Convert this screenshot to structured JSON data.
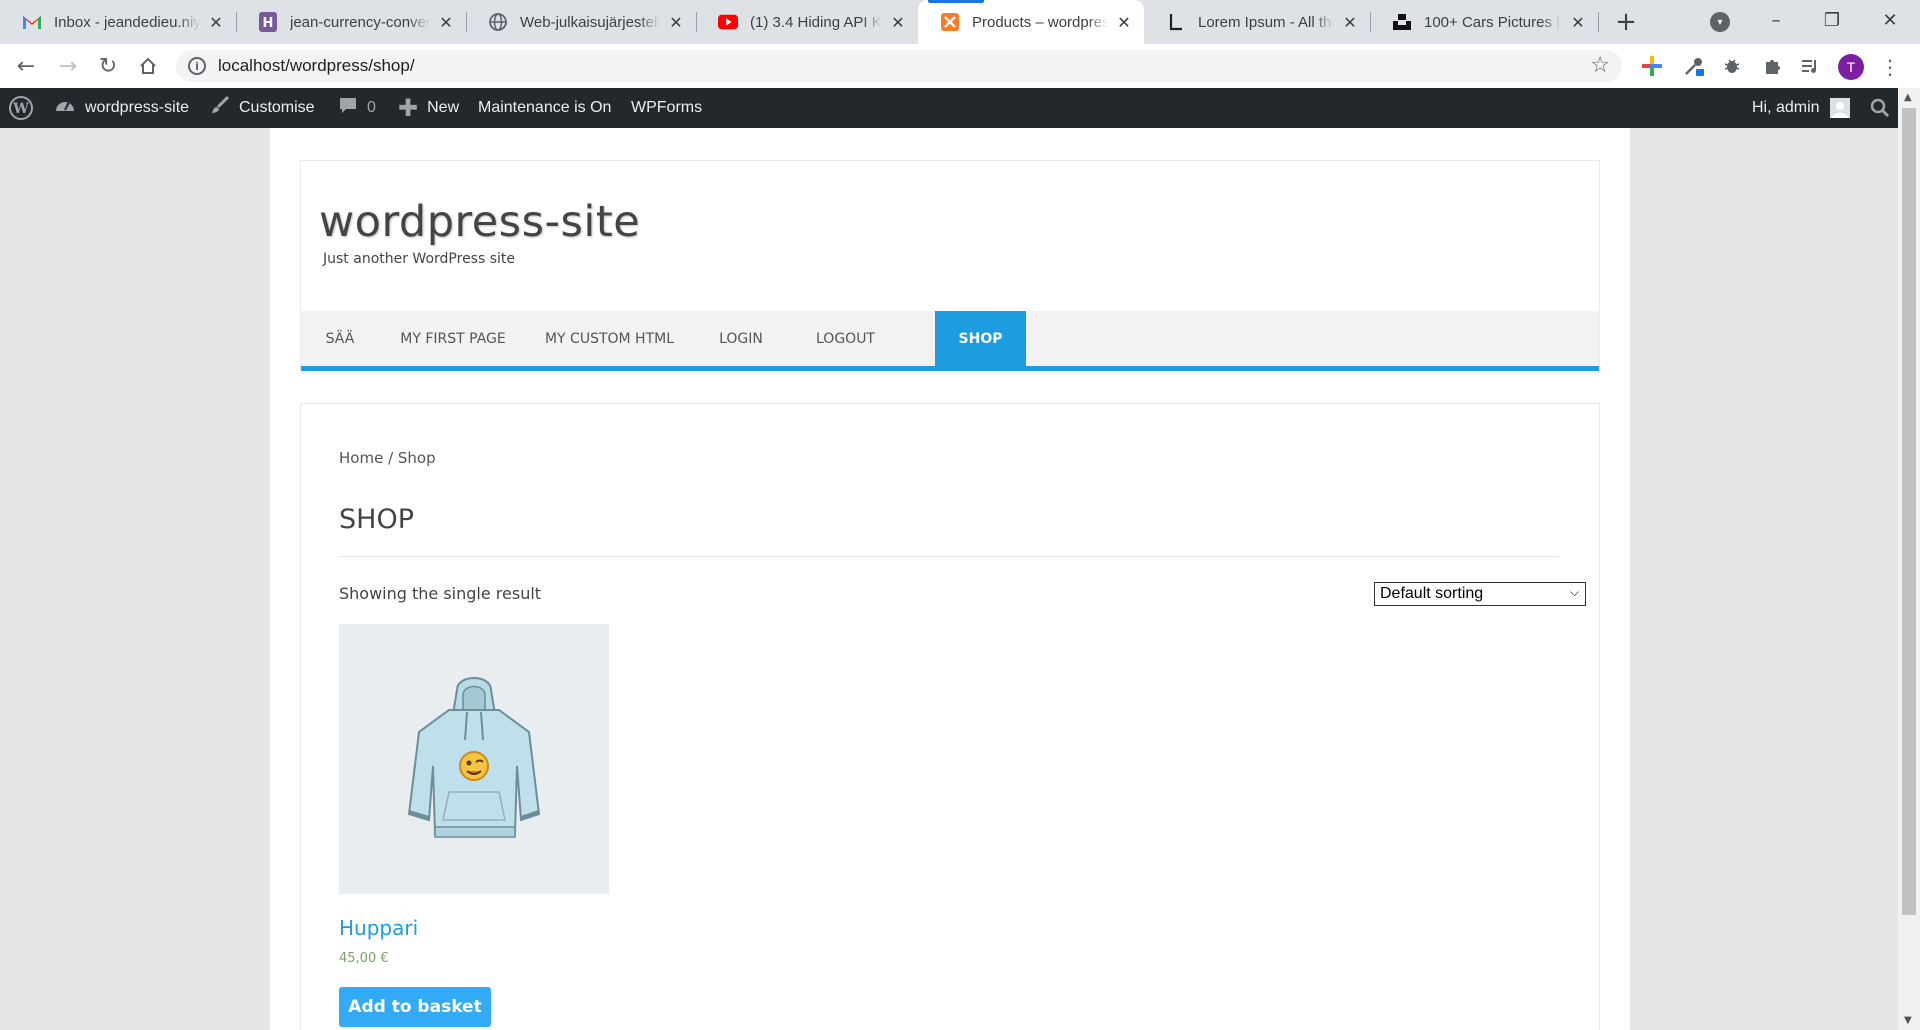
{
  "browser": {
    "tabs": [
      {
        "title": "Inbox - jeandedieu.niy",
        "icon": "gmail-icon"
      },
      {
        "title": "jean-currency-convert",
        "icon": "heroku-icon"
      },
      {
        "title": "Web-julkaisujärjestelm",
        "icon": "globe-icon"
      },
      {
        "title": "(1) 3.4 Hiding API Key",
        "icon": "youtube-icon"
      },
      {
        "title": "Products – wordpress-",
        "icon": "xampp-icon"
      },
      {
        "title": "Lorem Ipsum - All the",
        "icon": "lorem-icon"
      },
      {
        "title": "100+ Cars Pictures | D",
        "icon": "unsplash-icon"
      }
    ],
    "url": "localhost/wordpress/shop/",
    "profile_initial": "T"
  },
  "adminbar": {
    "site_name": "wordpress-site",
    "customise": "Customise",
    "comments_count": "0",
    "new_label": "New",
    "maintenance": "Maintenance is On",
    "wpforms": "WPForms",
    "greeting": "Hi, admin"
  },
  "site": {
    "title": "wordpress-site",
    "description": "Just another WordPress site"
  },
  "nav": {
    "items": [
      "SÄÄ",
      "MY FIRST PAGE",
      "MY CUSTOM HTML",
      "LOGIN",
      "LOGOUT",
      "SHOP"
    ],
    "current": "SHOP"
  },
  "shop": {
    "breadcrumb": "Home / Shop",
    "title": "SHOP",
    "result_count": "Showing the single result",
    "sorting": "Default sorting",
    "product": {
      "name": "Huppari",
      "price": "45,00 €",
      "button": "Add to basket"
    }
  },
  "colors": {
    "accent": "#1e9ce0",
    "button": "#33aaf5",
    "price": "#77a464",
    "adminbar": "#23282d"
  }
}
